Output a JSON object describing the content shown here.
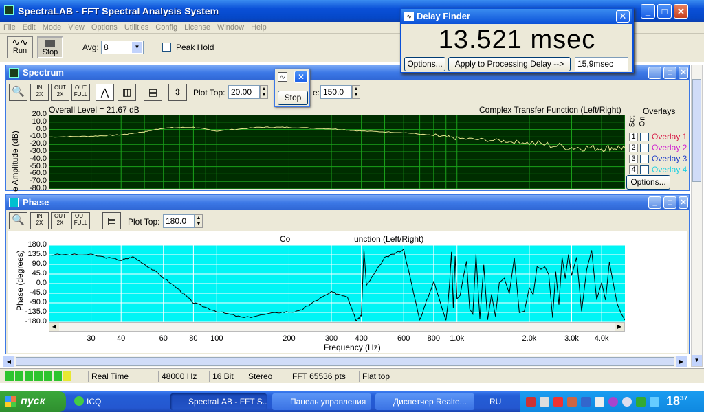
{
  "app": {
    "title": "SpectraLAB - FFT Spectral Analysis System",
    "menu": [
      "File",
      "Edit",
      "Mode",
      "View",
      "Options",
      "Utilities",
      "Config",
      "License",
      "Window",
      "Help"
    ],
    "run_label": "Run",
    "stop_label": "Stop",
    "avg_label": "Avg:",
    "avg_value": "8",
    "peak_hold_label": "Peak Hold"
  },
  "delay_finder": {
    "title": "Delay Finder",
    "readout": "13.521 msec",
    "options_label": "Options...",
    "apply_label": "Apply to Processing Delay -->",
    "delay_value": "15,9",
    "delay_unit": "msec"
  },
  "floating_stop": {
    "label": "Stop"
  },
  "spectrum": {
    "title": "Spectrum",
    "plot_top_label": "Plot Top:",
    "plot_top_value": "20.00",
    "range_label": "e:",
    "range_value": "150.0",
    "overall_level": "Overall Level = 21.67 dB",
    "chart_title": "Complex Transfer Function (Left/Right)",
    "ylabel": "e Amplitude (dB)",
    "yticks": [
      "20.0",
      "10.0",
      "0.0",
      "-10.0",
      "-20.0",
      "-30.0",
      "-40.0",
      "-50.0",
      "-60.0",
      "-70.0",
      "-80.0"
    ],
    "overlays_label": "Overlays",
    "set_label": "Set",
    "on_label": "On",
    "overlays": [
      {
        "num": "1",
        "name": "Overlay 1",
        "color": "#d8204a"
      },
      {
        "num": "2",
        "name": "Overlay 2",
        "color": "#d020d0"
      },
      {
        "num": "3",
        "name": "Overlay 3",
        "color": "#2040c8"
      },
      {
        "num": "4",
        "name": "Overlay 4",
        "color": "#20d0e0"
      }
    ],
    "options_label": "Options..."
  },
  "phase": {
    "title": "Phase",
    "plot_top_label": "Plot Top:",
    "plot_top_value": "180.0",
    "chart_title_left": "Co",
    "chart_title_right": "unction (Left/Right)",
    "ylabel": "Phase (degrees)",
    "yticks": [
      "180.0",
      "135.0",
      "90.0",
      "45.0",
      "0.0",
      "-45.0",
      "-90.0",
      "-135.0",
      "-180.0"
    ],
    "xlabel": "Frequency (Hz)",
    "xticks": [
      "30",
      "40",
      "60",
      "80",
      "100",
      "200",
      "300",
      "400",
      "600",
      "800",
      "1.0k",
      "2.0k",
      "3.0k",
      "4.0k"
    ]
  },
  "status": {
    "mode": "Real Time",
    "rate": "48000 Hz",
    "bits": "16 Bit",
    "channels": "Stereo",
    "fft": "FFT 65536 pts",
    "window": "Flat top"
  },
  "taskbar": {
    "start": "пуск",
    "quick": "ICQ",
    "tasks": [
      "SpectraLAB - FFT S...",
      "Панель управления",
      "Диспетчер Realte..."
    ],
    "lang": "RU",
    "clock": "18",
    "clock_min": "37"
  },
  "colors": {
    "spectrum_bg": "#002d00",
    "spectrum_grid": "#1aa21a",
    "spectrum_trace": "#e8e890",
    "phase_bg": "#00f5f5",
    "phase_trace": "#000000",
    "titlebar": "#0a50d8"
  },
  "chart_data": [
    {
      "type": "line",
      "title": "Complex Transfer Function (Left/Right)",
      "ylabel": "e Amplitude (dB)",
      "ylim": [
        -80,
        20
      ],
      "x": [
        20,
        30,
        40,
        50,
        60,
        80,
        100,
        150,
        200,
        300,
        400,
        600,
        800,
        1000,
        1500,
        2000,
        3000,
        4000,
        5000
      ],
      "series": [
        {
          "values": [
            -10,
            -9,
            -7,
            -3,
            2,
            3,
            -2,
            3,
            3,
            1,
            -2,
            -4,
            -8,
            -12,
            -15,
            -18,
            -24,
            -25,
            -24
          ]
        }
      ],
      "grid": true
    },
    {
      "type": "line",
      "title": "unction (Left/Right)",
      "ylabel": "Phase (degrees)",
      "xlabel": "Frequency (Hz)",
      "ylim": [
        -180,
        180
      ],
      "x": [
        20,
        30,
        40,
        45,
        55,
        70,
        80,
        100,
        130,
        180,
        220,
        250,
        300,
        350,
        380,
        400,
        410,
        420,
        500,
        600,
        700,
        800,
        900,
        1000,
        1200,
        1500,
        2000,
        2500,
        3000,
        4000,
        5000
      ],
      "series": [
        {
          "values": [
            135,
            135,
            110,
            125,
            60,
            -30,
            -90,
            -130,
            -160,
            -135,
            -130,
            -90,
            -40,
            -60,
            -170,
            -150,
            160,
            -10,
            120,
            160,
            -170,
            10,
            -170,
            40,
            -150,
            160,
            -170,
            170,
            -160,
            170,
            -170
          ]
        }
      ],
      "grid": true
    }
  ]
}
